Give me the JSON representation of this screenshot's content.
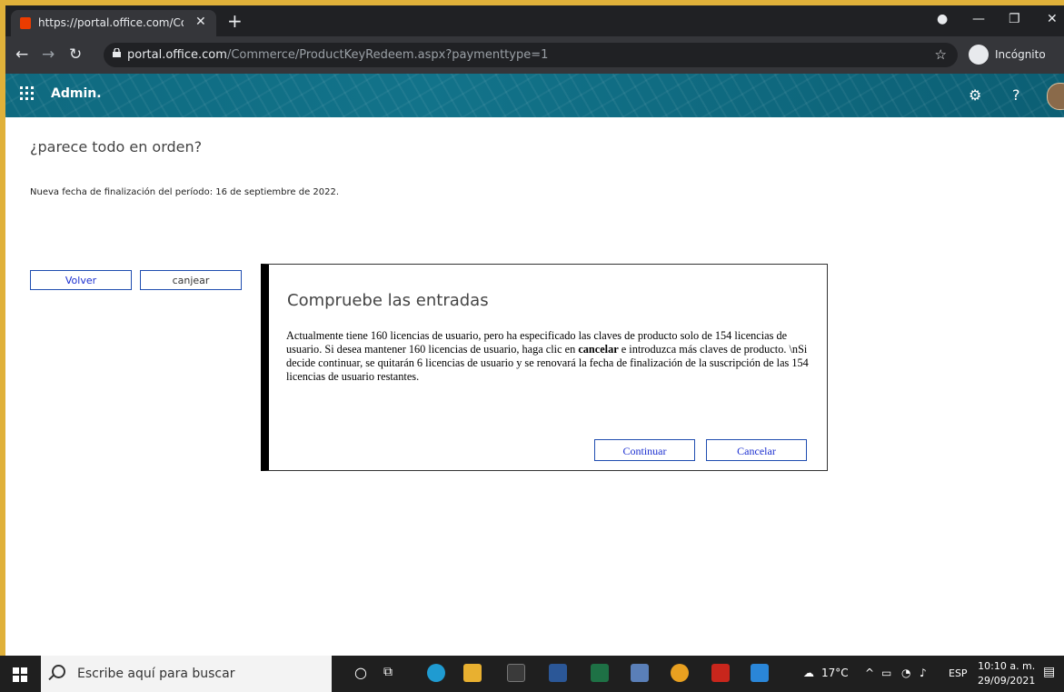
{
  "browser": {
    "tab_title": "https://portal.office.com/Comme",
    "url_domain": "portal.office.com",
    "url_path": "/Commerce/ProductKeyRedeem.aspx?paymenttype=1",
    "incognito_label": "Incógnito"
  },
  "header": {
    "app_name": "Admin."
  },
  "page": {
    "heading": "¿parece todo en orden?",
    "end_date_text": "Nueva fecha de finalización del período: 16 de septiembre de 2022.",
    "back_label": "Volver",
    "redeem_label": "canjear"
  },
  "dialog": {
    "title": "Compruebe las entradas",
    "body_part1": "Actualmente tiene 160 licencias de usuario, pero ha especificado las claves de producto solo de 154 licencias de usuario. Si desea mantener 160 licencias de usuario, haga clic en ",
    "body_bold": "cancelar",
    "body_part2": " e introduzca más claves de producto. \\nSi decide continuar, se quitarán 6 licencias de usuario y se renovará la fecha de finalización de la suscripción de las 154 licencias de usuario restantes.",
    "continue_label": "Continuar",
    "cancel_label": "Cancelar"
  },
  "taskbar": {
    "search_placeholder": "Escribe aquí para buscar",
    "weather": "17°C",
    "language": "ESP",
    "time": "10:10 a. m.",
    "date": "29/09/2021"
  }
}
